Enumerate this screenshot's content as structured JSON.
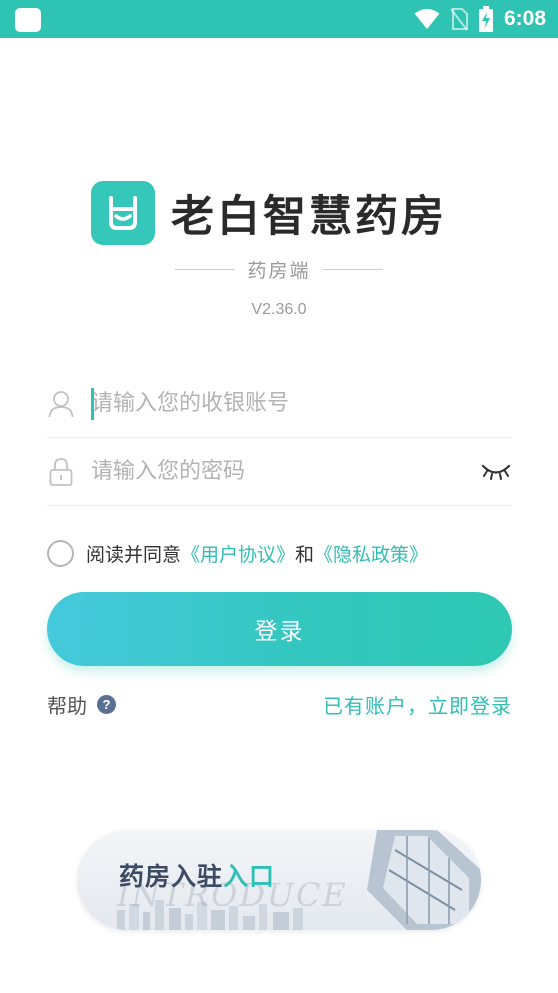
{
  "status_bar": {
    "time": "6:08",
    "icons": [
      "notification-square-icon",
      "wifi-icon",
      "no-sim-icon",
      "battery-charging-icon"
    ],
    "background": "#2fc3b4"
  },
  "brand": {
    "app_name": "老白智慧药房",
    "subtitle": "药房端",
    "version": "V2.36.0",
    "accent_color": "#2fc3b4"
  },
  "form": {
    "account_placeholder": "请输入您的收银账号",
    "password_placeholder": "请输入您的密码"
  },
  "agreement": {
    "prefix": "阅读并同意",
    "user_agreement": "《用户协议》",
    "and": "和",
    "privacy_policy": "《隐私政策》"
  },
  "login_button": "登录",
  "help": {
    "label": "帮助",
    "icon_glyph": "?"
  },
  "existing_account_link": "已有账户，立即登录",
  "banner": {
    "title_main": "药房入驻",
    "title_accent": "入口",
    "watermark": "INTRODUCE"
  }
}
